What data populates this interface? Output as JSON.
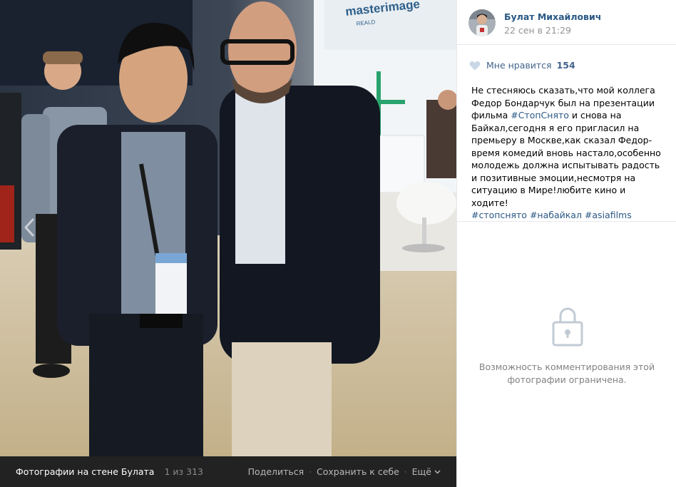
{
  "author": {
    "name": "Булат Михайлович",
    "date": "22 сен в 21:29",
    "avatar_icon": "user-avatar"
  },
  "likes": {
    "label": "Мне нравится",
    "count": "154",
    "icon": "heart-icon"
  },
  "post": {
    "text_1": "Не стесняюсь сказать,что мой коллега Федор Бондарчук был на презентации фильма ",
    "tag_1": "#СтопСнято",
    "text_2": " и снова на Байкал,сегодня я его пригласил на премьеру в Москве,как сказал Федор-время комедий вновь настало,особенно молодежь должна испытывать радость и позитивные эмоции,несмотря на ситуацию в Мире!любите кино и ходите!",
    "tag_2": "#стопснято",
    "tag_3": "#набайкал",
    "tag_4": "#asiafilms"
  },
  "comments": {
    "closed_text": "Возможность комментирования этой фотографии ограничена.",
    "icon": "lock-icon"
  },
  "viewer": {
    "album_title": "Фотографии на стене Булата",
    "counter": "1 из 313",
    "share_label": "Поделиться",
    "save_label": "Сохранить к себе",
    "more_label": "Ещё",
    "separator": "·",
    "banner_text": "masterimage",
    "banner_sub": "REALD"
  },
  "colors": {
    "link": "#2a5885",
    "like": "#42648b",
    "muted": "#939393",
    "bar_bg": "#222222"
  }
}
